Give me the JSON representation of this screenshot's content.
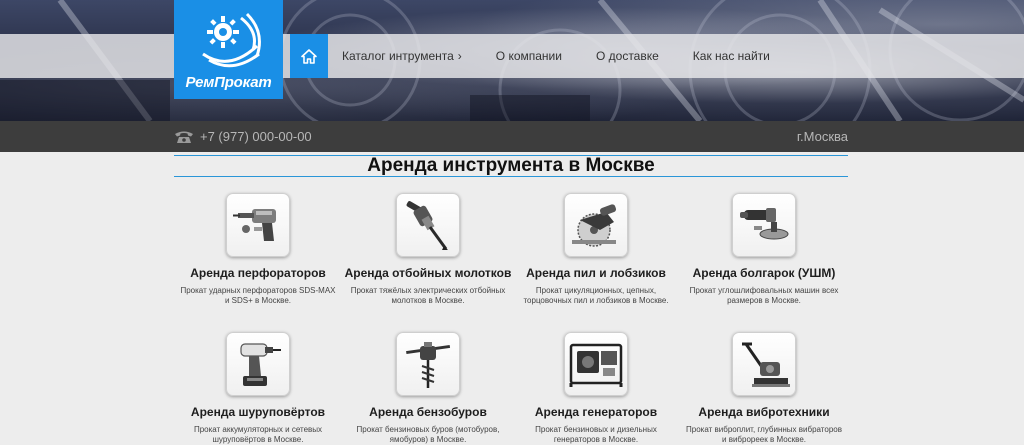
{
  "brand": {
    "name": "РемПрокат"
  },
  "nav": {
    "home_icon": "home-icon",
    "items": [
      {
        "label": "Каталог интрумента",
        "has_submenu": true
      },
      {
        "label": "О компании"
      },
      {
        "label": "О доставке"
      },
      {
        "label": "Как нас найти"
      }
    ]
  },
  "contact": {
    "phone": "+7 (977) 000-00-00",
    "city": "г.Москва"
  },
  "main": {
    "title": "Аренда инструмента в Москве",
    "cards": [
      {
        "title": "Аренда перфораторов",
        "desc": "Прокат ударных перфораторов SDS-MAX и SDS+ в Москве.",
        "icon": "rotary-hammer-icon"
      },
      {
        "title": "Аренда отбойных молотков",
        "desc": "Прокат тяжёлых электрических отбойных молотков в Москве.",
        "icon": "jackhammer-icon"
      },
      {
        "title": "Аренда пил и лобзиков",
        "desc": "Прокат цикуляционных, цепных, торцовочных пил и лобзиков в Москве.",
        "icon": "circular-saw-icon"
      },
      {
        "title": "Аренда болгарок (УШМ)",
        "desc": "Прокат углошлифовальных машин всех размеров в Москве.",
        "icon": "angle-grinder-icon"
      },
      {
        "title": "Аренда шуруповёртов",
        "desc": "Прокат аккумуляторных и сетевых шуруповёртов в Москве.",
        "icon": "cordless-drill-icon"
      },
      {
        "title": "Аренда бензобуров",
        "desc": "Прокат бензиновых буров (мотобуров, ямобуров) в Москве.",
        "icon": "earth-auger-icon"
      },
      {
        "title": "Аренда генераторов",
        "desc": "Прокат бензиновых и дизельных генераторов в Москве.",
        "icon": "generator-icon"
      },
      {
        "title": "Аренда вибротехники",
        "desc": "Прокат виброплит, глубинных вибраторов и виброреек в Москве.",
        "icon": "plate-compactor-icon"
      }
    ]
  },
  "colors": {
    "accent": "#1a8fe6",
    "contact_bar": "#3d3d3d",
    "title_rule": "#2a96d8",
    "page_bg": "#ededed"
  }
}
